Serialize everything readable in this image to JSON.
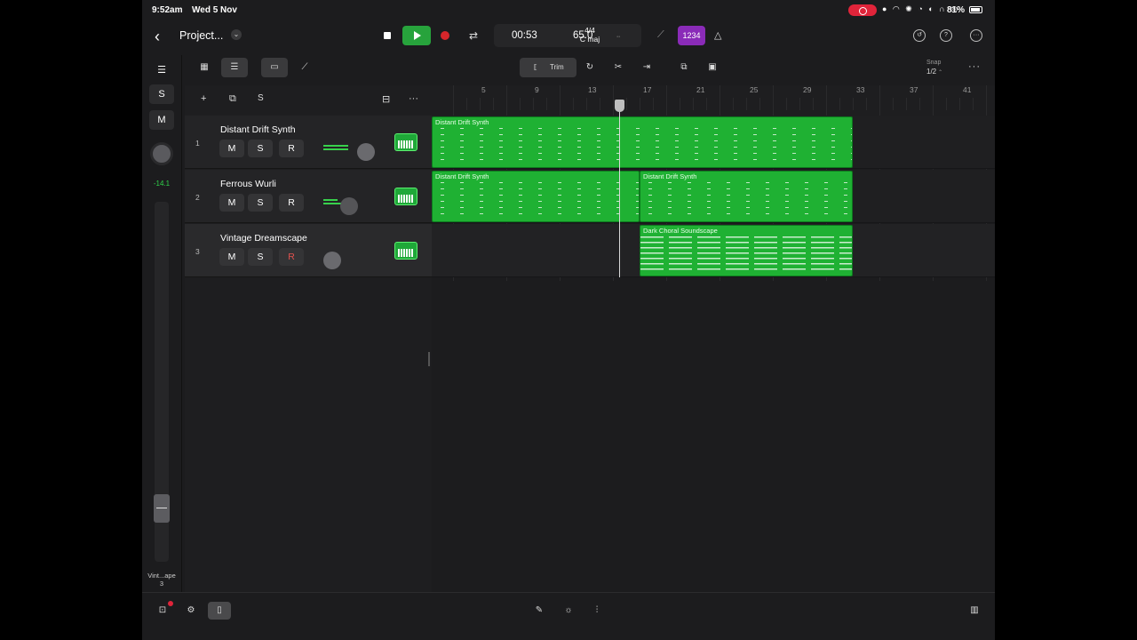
{
  "status_bar": {
    "time": "9:52am",
    "date": "Wed 5 Nov",
    "battery": "81%"
  },
  "header": {
    "project_title": "Project...",
    "lcd": {
      "position": "00:53",
      "tempo": "65.0",
      "time_signature": "4/4",
      "key": "C maj"
    },
    "count_in_label": "1234"
  },
  "left_strip": {
    "solo_label": "S",
    "mute_label": "M",
    "volume_readout": "-14.1",
    "track_name": "Vint...ape",
    "track_number": "3"
  },
  "toolbar": {
    "trim_label": "Trim",
    "snap_label": "Snap",
    "snap_value": "1/2"
  },
  "track_header_tools": {
    "solo_label": "S"
  },
  "tracks": [
    {
      "number": "1",
      "name": "Distant Drift Synth",
      "mute": "M",
      "solo": "S",
      "record": "R"
    },
    {
      "number": "2",
      "name": "Ferrous Wurli",
      "mute": "M",
      "solo": "S",
      "record": "R"
    },
    {
      "number": "3",
      "name": "Vintage Dreamscape",
      "mute": "M",
      "solo": "S",
      "record": "R"
    }
  ],
  "ruler": {
    "bars": [
      "5",
      "9",
      "13",
      "17",
      "21",
      "25",
      "29",
      "33",
      "37",
      "41"
    ]
  },
  "regions": [
    {
      "name": "Distant Drift Synth"
    },
    {
      "name": "Distant Drift Synth"
    },
    {
      "name": "Distant Drift Synth"
    },
    {
      "name": "Dark Choral Soundscape"
    }
  ],
  "colors": {
    "region": "#1fb133",
    "play": "#27a33c",
    "record": "#d7262b",
    "count_in": "#8a2bb8",
    "meter": "#38d14c"
  }
}
